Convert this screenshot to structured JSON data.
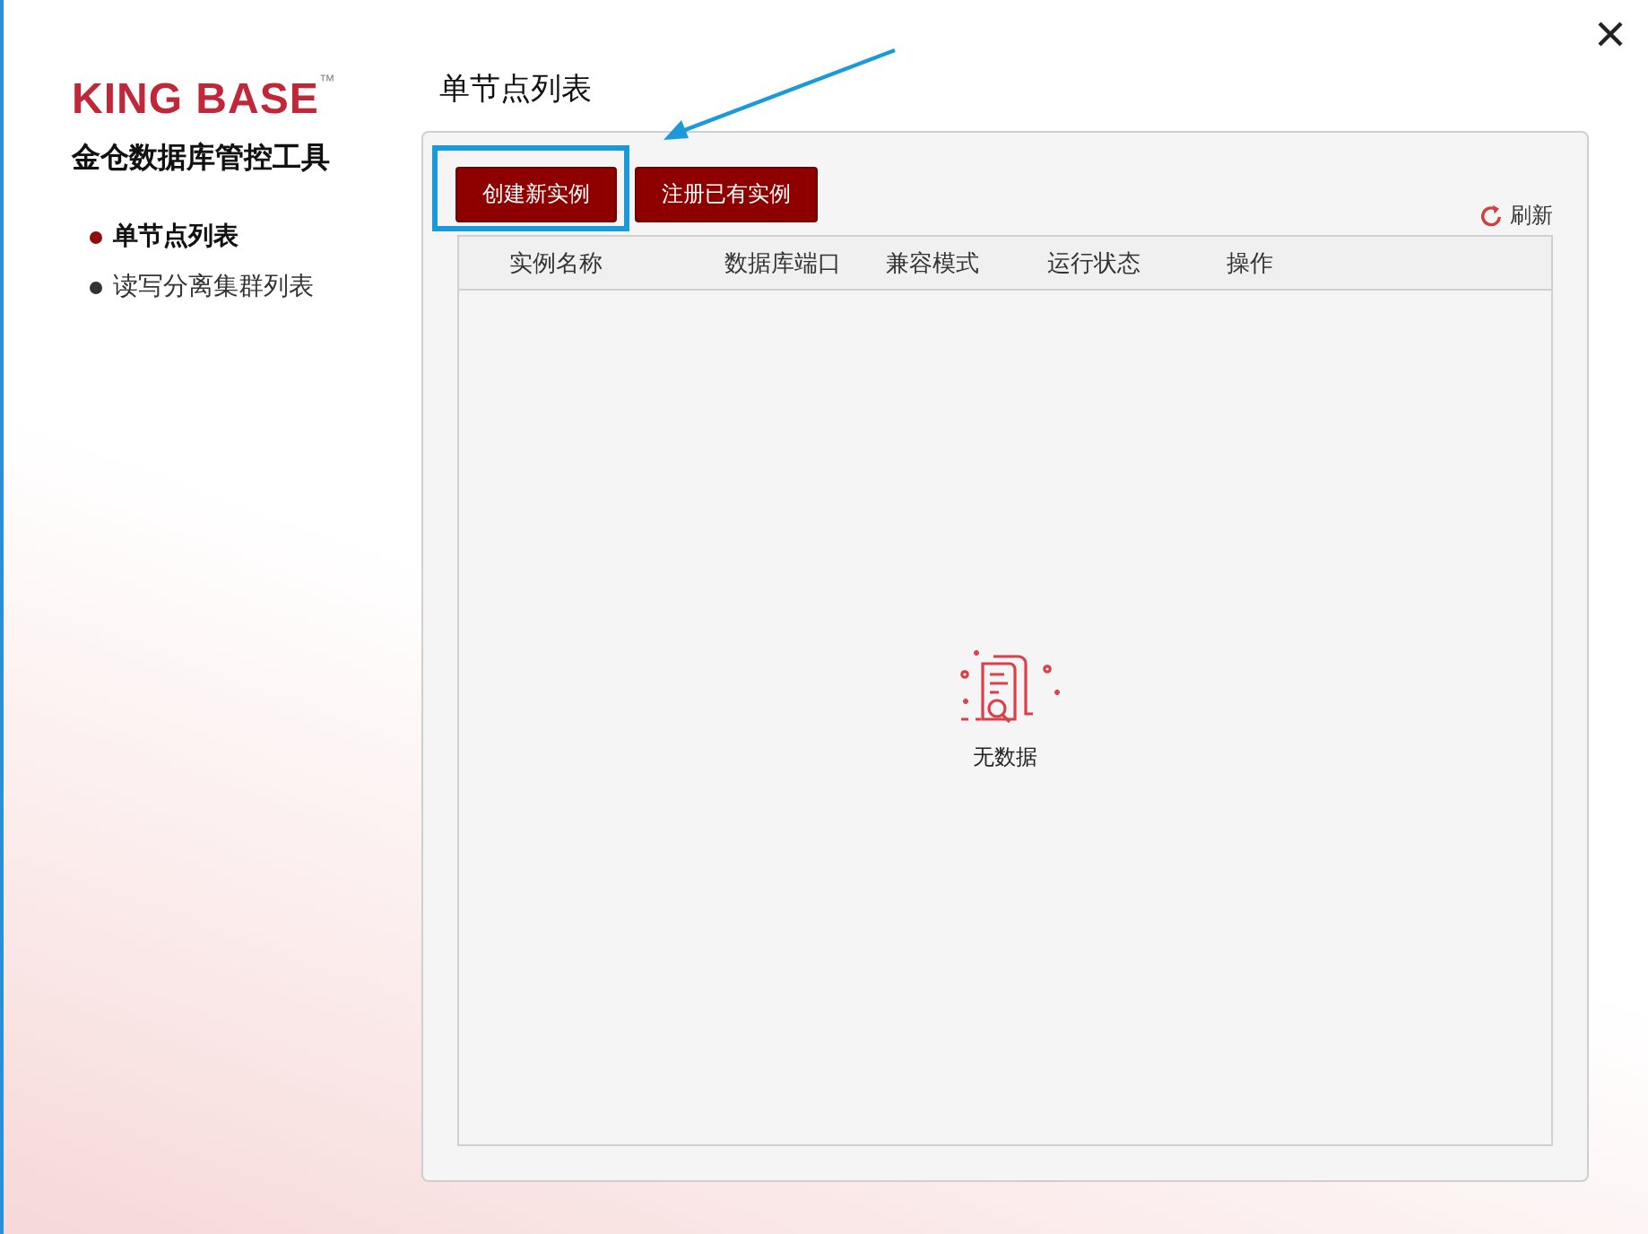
{
  "logo": {
    "name": "KING BASE",
    "mark": "™"
  },
  "app_title": "金仓数据库管控工具",
  "sidebar": {
    "items": [
      {
        "label": "单节点列表",
        "selected": true
      },
      {
        "label": "读写分离集群列表",
        "selected": false
      }
    ]
  },
  "page_title": "单节点列表",
  "toolbar": {
    "buttons": [
      {
        "label": "创建新实例",
        "highlighted": true
      },
      {
        "label": "注册已有实例",
        "highlighted": false
      }
    ],
    "refresh": "刷新"
  },
  "table": {
    "columns": [
      "实例名称",
      "数据库端口",
      "兼容模式",
      "运行状态",
      "操作"
    ],
    "empty_text": "无数据"
  }
}
